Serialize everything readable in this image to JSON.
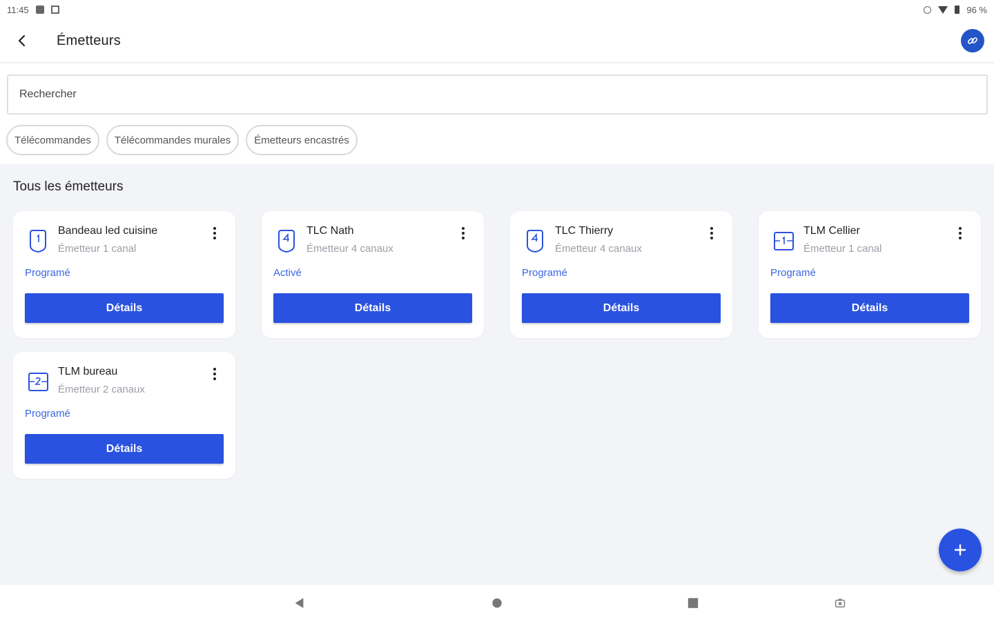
{
  "status_bar": {
    "time": "11:45",
    "battery": "96 %"
  },
  "app_bar": {
    "title": "Émetteurs",
    "back_icon": "arrow-left-icon",
    "link_icon": "link-icon",
    "accent_color": "#2454c7"
  },
  "search": {
    "placeholder": "Rechercher",
    "value": ""
  },
  "filters": [
    {
      "label": "Télécommandes"
    },
    {
      "label": "Télécommandes murales"
    },
    {
      "label": "Émetteurs encastrés"
    }
  ],
  "section": {
    "title": "Tous les émetteurs"
  },
  "devices": [
    {
      "name": "Bandeau led cuisine",
      "type": "Émetteur 1 canal",
      "status": "Programé",
      "button": "Détails",
      "icon": "remote-1-channel-icon"
    },
    {
      "name": "TLC Nath",
      "type": "Émetteur 4 canaux",
      "status": "Activé",
      "button": "Détails",
      "icon": "remote-4-channel-icon"
    },
    {
      "name": "TLC Thierry",
      "type": "Émetteur 4 canaux",
      "status": "Programé",
      "button": "Détails",
      "icon": "remote-4-channel-icon"
    },
    {
      "name": "TLM Cellier",
      "type": "Émetteur 1 canal",
      "status": "Programé",
      "button": "Détails",
      "icon": "wall-switch-1-channel-icon"
    },
    {
      "name": "TLM bureau",
      "type": "Émetteur 2 canaux",
      "status": "Programé",
      "button": "Détails",
      "icon": "wall-switch-2-channel-icon"
    }
  ],
  "colors": {
    "primary_button": "#2a52e0",
    "status_text": "#3b66e0",
    "background": "#f3f4f7"
  },
  "fab": {
    "icon": "plus-icon"
  }
}
